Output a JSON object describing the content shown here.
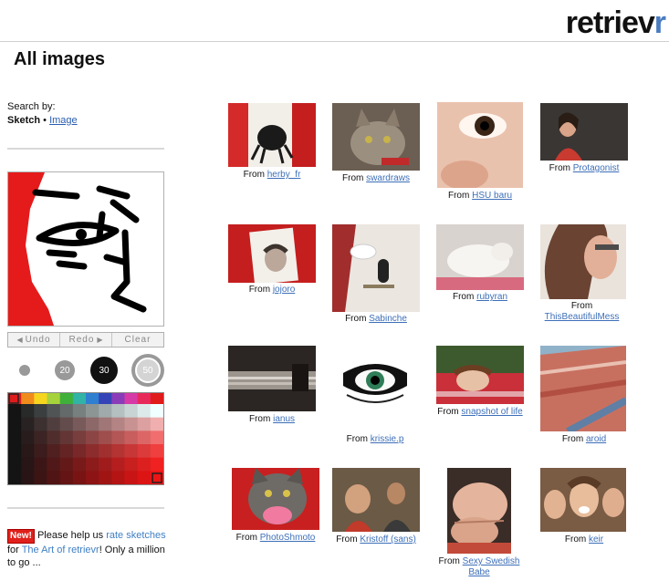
{
  "header": {
    "logo_main": "retriev",
    "logo_accent": "r",
    "page_title": "All images"
  },
  "search": {
    "label": "Search by:",
    "mode_sketch": "Sketch",
    "mode_separator": "•",
    "mode_image": "Image"
  },
  "sketch_tools": {
    "undo_label": "Undo",
    "redo_label": "Redo",
    "clear_label": "Clear",
    "brush_sizes": [
      "20",
      "30",
      "50"
    ],
    "selected_brush": "30",
    "palette_colors": [
      "#e01b1b",
      "#f08c1c",
      "#f5d51e",
      "#a6d23c",
      "#3fb03a",
      "#31b3a6",
      "#2f7fd0",
      "#3444b8",
      "#8a3cb8",
      "#d63aa6",
      "#e82a5a",
      "#e01b1b"
    ]
  },
  "news": {
    "badge": "New!",
    "text1": "Please help us",
    "link1": "rate sketches",
    "text2": "for",
    "link2": "The Art of retrievr",
    "text3": "! Only a million to go ..."
  },
  "results": {
    "from_label": "From",
    "items": [
      {
        "user": "herby_fr"
      },
      {
        "user": "swardraws"
      },
      {
        "user": "HSU baru"
      },
      {
        "user": "Protagonist"
      },
      {
        "user": "jojoro"
      },
      {
        "user": "Sabinche"
      },
      {
        "user": "rubyran"
      },
      {
        "user": "ThisBeautifulMess"
      },
      {
        "user": "ianus"
      },
      {
        "user": "krissie.p"
      },
      {
        "user": "snapshot of life"
      },
      {
        "user": "aroid"
      },
      {
        "user": "PhotoShmoto"
      },
      {
        "user": "Kristoff (sans)"
      },
      {
        "user": "Sexy Swedish Babe"
      },
      {
        "user": "keir"
      }
    ]
  }
}
